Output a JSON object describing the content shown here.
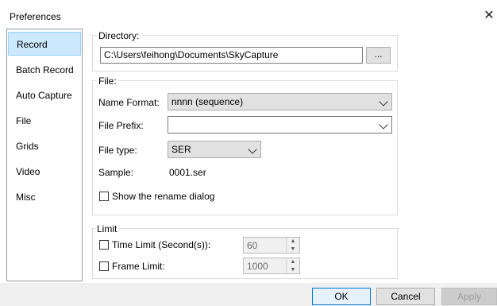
{
  "window": {
    "title": "Preferences",
    "close_glyph": "✕"
  },
  "sidebar": {
    "items": [
      {
        "label": "Record",
        "selected": true
      },
      {
        "label": "Batch Record"
      },
      {
        "label": "Auto Capture"
      },
      {
        "label": "File"
      },
      {
        "label": "Grids"
      },
      {
        "label": "Video"
      },
      {
        "label": "Misc"
      }
    ]
  },
  "directory": {
    "group_label": "Directory:",
    "path": "C:\\Users\\feihong\\Documents\\SkyCapture",
    "browse_label": "..."
  },
  "file": {
    "group_label": "File:",
    "name_format_label": "Name Format:",
    "name_format_value": "nnnn (sequence)",
    "prefix_label": "File Prefix:",
    "prefix_value": "",
    "type_label": "File type:",
    "type_value": "SER",
    "sample_label": "Sample:",
    "sample_value": "0001.ser",
    "rename_dialog_label": "Show the rename dialog",
    "rename_dialog_checked": false
  },
  "limit": {
    "group_label": "Limit",
    "time_label": "Time Limit (Second(s)):",
    "time_value": "60",
    "time_checked": false,
    "frame_label": "Frame Limit:",
    "frame_value": "1000",
    "frame_checked": false
  },
  "buttons": {
    "ok": "OK",
    "cancel": "Cancel",
    "apply": "Apply"
  },
  "colors": {
    "selection": "#cce8ff",
    "ok_border": "#0078d7"
  }
}
